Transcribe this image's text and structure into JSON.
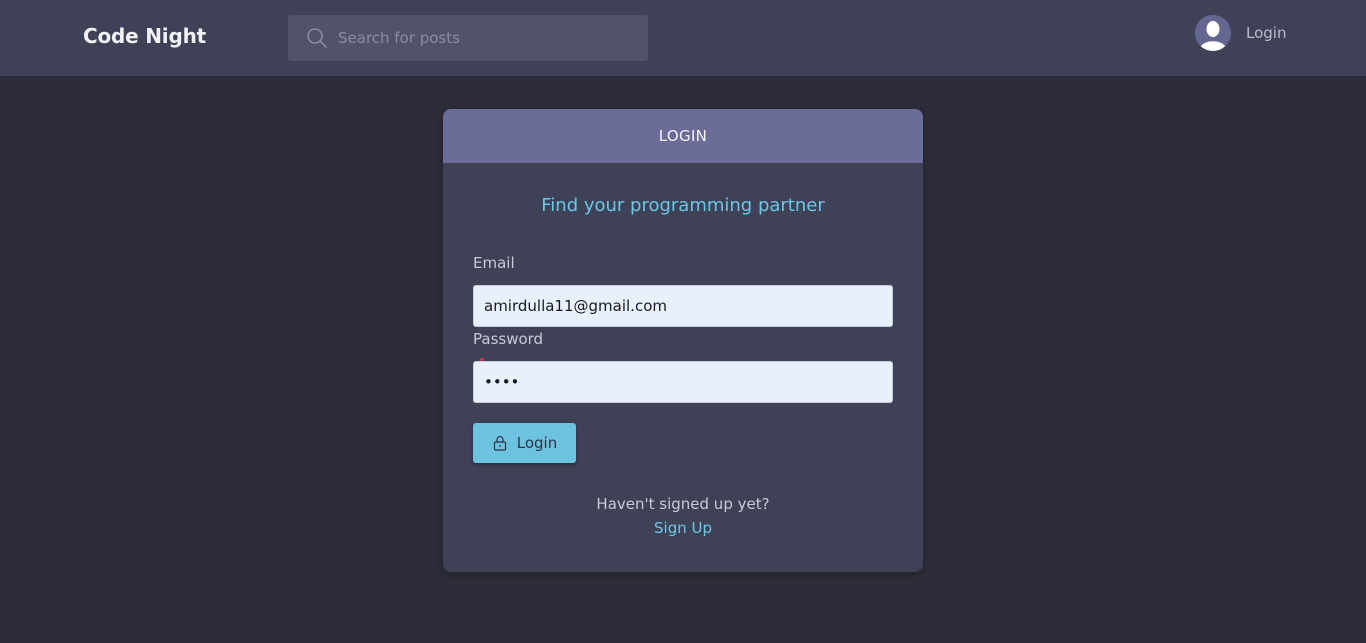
{
  "navbar": {
    "brand": "Code Night",
    "search_placeholder": "Search for posts",
    "login_label": "Login"
  },
  "card": {
    "header": "LOGIN",
    "tagline": "Find your programming partner",
    "email_label": "Email",
    "email_value": "amirdulla11@gmail.com",
    "password_label": "Password",
    "password_value": "1234",
    "login_button": "Login",
    "signup_prompt": "Haven't signed up yet?",
    "signup_link": "Sign Up"
  },
  "colors": {
    "background": "#2d2d39",
    "navbar": "#3f4157",
    "card_header": "#6b6c98",
    "accent": "#6cc7e6",
    "button": "#6cc3df"
  },
  "icons": [
    "search-icon",
    "avatar-icon",
    "lock-icon"
  ]
}
